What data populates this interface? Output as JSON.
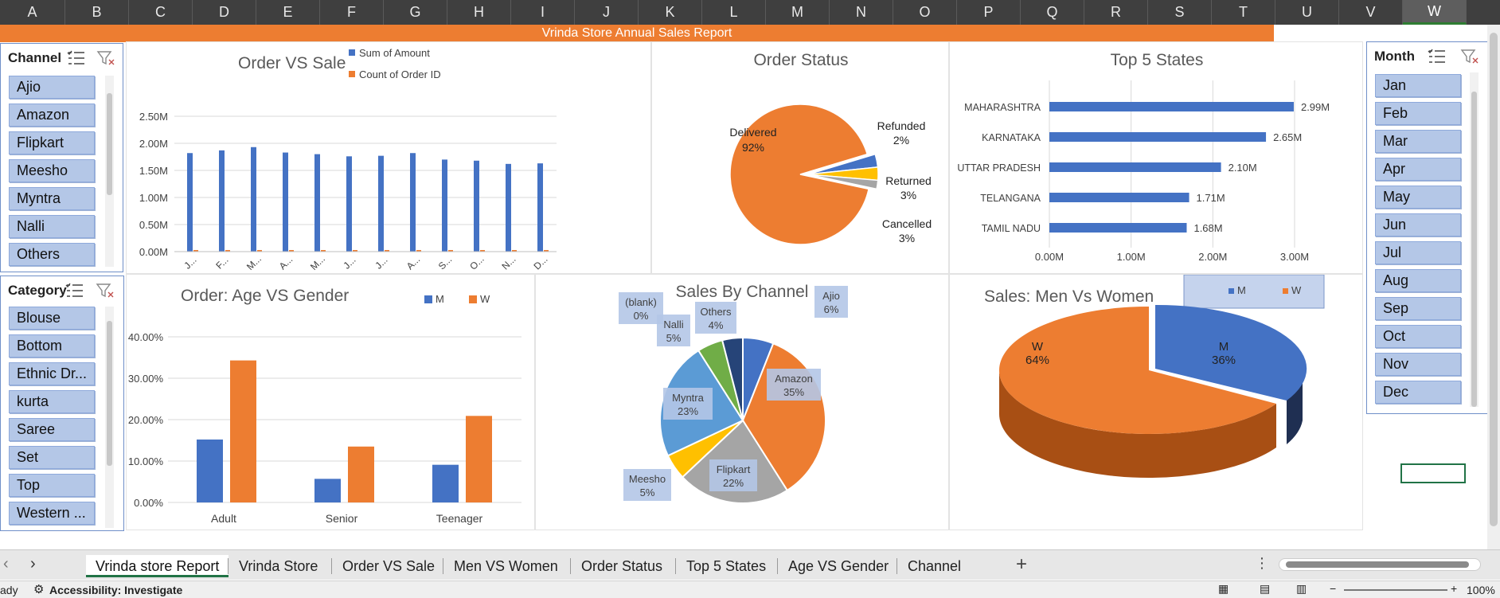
{
  "columns": [
    "A",
    "B",
    "C",
    "D",
    "E",
    "F",
    "G",
    "H",
    "I",
    "J",
    "K",
    "L",
    "M",
    "N",
    "O",
    "P",
    "Q",
    "R",
    "S",
    "T",
    "U",
    "V",
    "W"
  ],
  "selected_column": "W",
  "report_title": "Vrinda Store Annual Sales Report",
  "slicers": {
    "channel": {
      "title": "Channel",
      "items": [
        "Ajio",
        "Amazon",
        "Flipkart",
        "Meesho",
        "Myntra",
        "Nalli",
        "Others"
      ]
    },
    "category": {
      "title": "Category",
      "items": [
        "Blouse",
        "Bottom",
        "Ethnic Dr...",
        "kurta",
        "Saree",
        "Set",
        "Top",
        "Western ..."
      ]
    },
    "month": {
      "title": "Month",
      "items": [
        "Jan",
        "Feb",
        "Mar",
        "Apr",
        "May",
        "Jun",
        "Jul",
        "Aug",
        "Sep",
        "Oct",
        "Nov",
        "Dec"
      ]
    }
  },
  "chart_data": [
    {
      "type": "bar",
      "title": "Order VS Sale",
      "categories": [
        "J...",
        "F...",
        "M...",
        "A...",
        "M...",
        "J...",
        "J...",
        "A...",
        "S...",
        "O...",
        "N...",
        "D..."
      ],
      "series": [
        {
          "name": "Sum of Amount",
          "values": [
            1.82,
            1.87,
            1.93,
            1.83,
            1.8,
            1.76,
            1.77,
            1.82,
            1.7,
            1.68,
            1.62,
            1.63
          ]
        },
        {
          "name": "Count of Order ID",
          "values": [
            0.003,
            0.003,
            0.003,
            0.003,
            0.003,
            0.003,
            0.003,
            0.003,
            0.003,
            0.003,
            0.003,
            0.003
          ]
        }
      ],
      "yticks": [
        "0.00M",
        "0.50M",
        "1.00M",
        "1.50M",
        "2.00M",
        "2.50M"
      ],
      "ylim": [
        0,
        2.5
      ],
      "colors": [
        "#4472c4",
        "#ed7d31"
      ],
      "legend": "top-right"
    },
    {
      "type": "pie",
      "title": "Order Status",
      "slices": [
        {
          "label": "Delivered",
          "value": 92,
          "pct": "92%",
          "color": "#ed7d31"
        },
        {
          "label": "Cancelled",
          "value": 3,
          "pct": "3%",
          "color": "#4472c4"
        },
        {
          "label": "Returned",
          "value": 3,
          "pct": "3%",
          "color": "#ffc000"
        },
        {
          "label": "Refunded",
          "value": 2,
          "pct": "2%",
          "color": "#a5a5a5"
        }
      ]
    },
    {
      "type": "bar",
      "orientation": "horizontal",
      "title": "Top 5 States",
      "categories": [
        "MAHARASHTRA",
        "KARNATAKA",
        "UTTAR PRADESH",
        "TELANGANA",
        "TAMIL NADU"
      ],
      "values": [
        2.99,
        2.65,
        2.1,
        1.71,
        1.68
      ],
      "labels": [
        "2.99M",
        "2.65M",
        "2.10M",
        "1.71M",
        "1.68M"
      ],
      "xticks": [
        "0.00M",
        "1.00M",
        "2.00M",
        "3.00M"
      ],
      "xlim": [
        0,
        3
      ],
      "color": "#4472c4"
    },
    {
      "type": "bar",
      "title": "Order: Age VS Gender",
      "categories": [
        "Adult",
        "Senior",
        "Teenager"
      ],
      "series": [
        {
          "name": "M",
          "values": [
            15.2,
            5.7,
            9.1
          ]
        },
        {
          "name": "W",
          "values": [
            34.3,
            13.5,
            20.9
          ]
        }
      ],
      "yticks": [
        "0.00%",
        "10.00%",
        "20.00%",
        "30.00%",
        "40.00%"
      ],
      "ylim": [
        0,
        40
      ],
      "colors": [
        "#4472c4",
        "#ed7d31"
      ],
      "legend": "top-right"
    },
    {
      "type": "pie",
      "title": "Sales By Channel",
      "slices": [
        {
          "label": "Ajio",
          "value": 6,
          "pct": "6%",
          "color": "#4472c4"
        },
        {
          "label": "Amazon",
          "value": 35,
          "pct": "35%",
          "color": "#ed7d31"
        },
        {
          "label": "Flipkart",
          "value": 22,
          "pct": "22%",
          "color": "#a5a5a5"
        },
        {
          "label": "Meesho",
          "value": 5,
          "pct": "5%",
          "color": "#ffc000"
        },
        {
          "label": "Myntra",
          "value": 23,
          "pct": "23%",
          "color": "#5b9bd5"
        },
        {
          "label": "Nalli",
          "value": 5,
          "pct": "5%",
          "color": "#70ad47"
        },
        {
          "label": "Others",
          "value": 4,
          "pct": "4%",
          "color": "#264478"
        },
        {
          "label": "(blank)",
          "value": 0,
          "pct": "0%",
          "color": "#9e480e"
        }
      ]
    },
    {
      "type": "pie",
      "style": "3d",
      "title": "Sales: Men Vs Women",
      "slices": [
        {
          "label": "M",
          "value": 36,
          "pct": "36%",
          "color": "#4472c4"
        },
        {
          "label": "W",
          "value": 64,
          "pct": "64%",
          "color": "#ed7d31"
        }
      ],
      "legend": [
        "M",
        "W"
      ],
      "legend_position": "top-right"
    }
  ],
  "sheet_tabs": [
    "Vrinda store Report",
    "Vrinda Store",
    "Order VS Sale",
    "Men VS Women",
    "Order Status",
    "Top 5 States",
    "Age VS Gender",
    "Channel"
  ],
  "active_tab": "Vrinda store Report",
  "status": {
    "ready": "ady",
    "accessibility": "Accessibility: Investigate",
    "zoom": "100%"
  },
  "add_sheet": "+"
}
